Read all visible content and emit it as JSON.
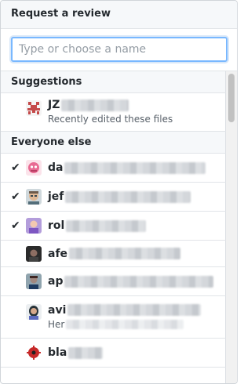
{
  "header": {
    "title": "Request a review"
  },
  "search": {
    "placeholder": "Type or choose a name",
    "value": ""
  },
  "sections": {
    "suggestions_title": "Suggestions",
    "everyone_title": "Everyone else"
  },
  "suggestions": [
    {
      "login": "JZ",
      "desc": "Recently edited these files",
      "selected": false,
      "avatar": "pixel-invader-avatar"
    }
  ],
  "everyone": [
    {
      "login": "da",
      "selected": true,
      "avatar": "pink-character-avatar"
    },
    {
      "login": "jef",
      "selected": true,
      "avatar": "cartoon-face-avatar"
    },
    {
      "login": "rol",
      "selected": true,
      "avatar": "photo-avatar"
    },
    {
      "login": "afe",
      "selected": false,
      "avatar": "dark-photo-avatar"
    },
    {
      "login": "ap",
      "selected": false,
      "avatar": "man-photo-avatar"
    },
    {
      "login": "avi",
      "desc": "Her",
      "selected": false,
      "avatar": "woman-photo-avatar"
    },
    {
      "login": "bla",
      "selected": false,
      "avatar": "red-gear-avatar"
    }
  ],
  "icons": {
    "check": "check-icon"
  },
  "colors": {
    "focus_border": "#79b8ff",
    "header_bg": "#f6f8fa",
    "border": "#e1e4e8"
  }
}
